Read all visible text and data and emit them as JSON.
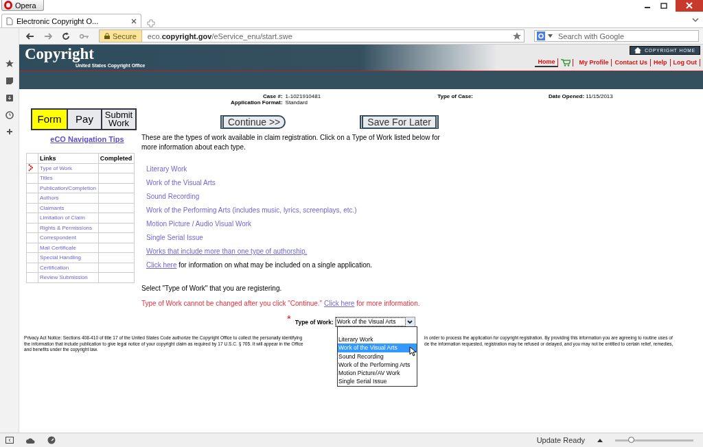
{
  "browser": {
    "app_button": "Opera",
    "tab_title": "Electronic Copyright O...",
    "secure_label": "Secure",
    "url_prefix": "eco.",
    "url_domain": "copyright.gov",
    "url_path": "/eService_enu/start.swe",
    "search_placeholder": "Search with Google"
  },
  "header": {
    "logo": "Copyright",
    "subtitle": "United States Copyright Office",
    "home_button": "COPYRIGHT HOME",
    "nav": [
      {
        "kind": "link",
        "label": "Home",
        "selected": true
      },
      {
        "kind": "cart",
        "selected": false
      },
      {
        "kind": "link",
        "label": "My Profile",
        "selected": false
      },
      {
        "kind": "link",
        "label": "Contact Us",
        "selected": false
      },
      {
        "kind": "link",
        "label": "Help",
        "selected": false
      },
      {
        "kind": "link",
        "label": "Log Out",
        "selected": false
      }
    ]
  },
  "steps": [
    {
      "label": "Form",
      "selected": true
    },
    {
      "label": "Pay",
      "selected": false
    },
    {
      "label": "Submit Work",
      "selected": false
    }
  ],
  "nav_tips": "eCO Navigation Tips",
  "links_table": {
    "columns": [
      "Links",
      "Completed"
    ],
    "rows": [
      {
        "label": "Type of Work",
        "current": true
      },
      {
        "label": "Titles",
        "current": false
      },
      {
        "label": "Publication/Completion",
        "current": false
      },
      {
        "label": "Authors",
        "current": false
      },
      {
        "label": "Claimants",
        "current": false
      },
      {
        "label": "Limitation of Claim",
        "current": false
      },
      {
        "label": "Rights & Permissions",
        "current": false
      },
      {
        "label": "Correspondent",
        "current": false
      },
      {
        "label": "Mail Certificate",
        "current": false
      },
      {
        "label": "Special Handling",
        "current": false
      },
      {
        "label": "Certification",
        "current": false
      },
      {
        "label": "Review Submission",
        "current": false
      }
    ]
  },
  "case_info": {
    "case_label": "Case #:",
    "case_value": "1-1021910481",
    "format_label": "Application Format:",
    "format_value": "Standard",
    "type_label": "Type of Case:",
    "date_label": "Date Opened:",
    "date_value": "11/15/2013"
  },
  "buttons": [
    "Continue >>",
    "Save For Later"
  ],
  "intro": "These are the types of work available in claim registration. Click on a Type of Work listed below for more information about each type.",
  "work_types": [
    {
      "kind": "plain",
      "label": "Literary Work"
    },
    {
      "kind": "plain",
      "label": "Work of the Visual Arts"
    },
    {
      "kind": "plain",
      "label": "Sound Recording"
    },
    {
      "kind": "plain",
      "label": "Work of the Performing Arts (includes music, lyrics, screenplays, etc.)"
    },
    {
      "kind": "plain",
      "label": "Motion Picture / Audio Visual Work"
    },
    {
      "kind": "plain",
      "label": "Single Serial Issue"
    },
    {
      "kind": "underlined",
      "label": "Works that include more than one type of authorship."
    }
  ],
  "single_app": {
    "link": "Click here",
    "text": "for information on what may be included on a single application."
  },
  "select_prompt": "Select \"Type of Work\" that you are registering.",
  "warning": {
    "text": "Type of Work cannot be changed after you click \"Continue.\"",
    "link": "Click here",
    "after": "for more information."
  },
  "type_field": {
    "required_mark": "*",
    "label": "Type of Work:",
    "value": "Work of the Visual Arts",
    "options": [
      {
        "label": "Literary Work",
        "selected": false
      },
      {
        "label": "Work of the Visual Arts",
        "selected": true
      },
      {
        "label": "Sound Recording",
        "selected": false
      },
      {
        "label": "Work of the Performing Arts",
        "selected": false
      },
      {
        "label": "Motion Picture/AV Work",
        "selected": false
      },
      {
        "label": "Single Serial Issue",
        "selected": false
      }
    ]
  },
  "privacy_notice": [
    {
      "left": "Privacy Act Notice: Sections 408-410 of title 17 of the United States Code authorize the Copyright Office to collect the personally identifying",
      "right": "in order to process the application for copyright registration. By providing this information you are agreeing to routine uses of"
    },
    {
      "left": "the information that include publication to give legal notice of your copyright claim as required by 17 U.S.C. § 705. It will appear in the Office",
      "right": "de the information requested, registration may be refused or delayed, and you may not be entitled to certain relief, remedies,"
    },
    {
      "left": "and benefits under the copyright law."
    }
  ],
  "status_bar": {
    "update": "Update Ready",
    "zoom": {
      "level": 0.2
    }
  }
}
